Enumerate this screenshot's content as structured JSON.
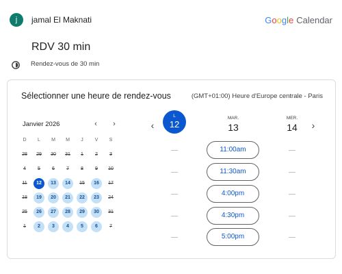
{
  "header": {
    "avatar_letter": "j",
    "user_name": "jamal El Maknati",
    "brand_g": [
      "G",
      "o",
      "o",
      "g",
      "l",
      "e"
    ],
    "brand_app": "Calendar"
  },
  "event": {
    "title": "RDV 30 min",
    "duration_text": "Rendez-vous de 30 min",
    "duration_icon": "clock-icon"
  },
  "booking": {
    "title": "Sélectionner une heure de rendez-vous",
    "timezone": "(GMT+01:00) Heure d'Europe centrale - Paris",
    "mini_calendar": {
      "month_label": "Janvier 2026",
      "prev": "‹",
      "next": "›",
      "weekdays": [
        "D",
        "L",
        "M",
        "M",
        "J",
        "V",
        "S"
      ],
      "weeks": [
        [
          {
            "d": "28",
            "s": "past"
          },
          {
            "d": "29",
            "s": "past"
          },
          {
            "d": "30",
            "s": "past"
          },
          {
            "d": "31",
            "s": "past"
          },
          {
            "d": "1",
            "s": "past"
          },
          {
            "d": "2",
            "s": "past"
          },
          {
            "d": "3",
            "s": "past"
          }
        ],
        [
          {
            "d": "4",
            "s": "past"
          },
          {
            "d": "5",
            "s": "past"
          },
          {
            "d": "6",
            "s": "past"
          },
          {
            "d": "7",
            "s": "past"
          },
          {
            "d": "8",
            "s": "past"
          },
          {
            "d": "9",
            "s": "past"
          },
          {
            "d": "10",
            "s": "past"
          }
        ],
        [
          {
            "d": "11",
            "s": "past"
          },
          {
            "d": "12",
            "s": "selected"
          },
          {
            "d": "13",
            "s": "avail"
          },
          {
            "d": "14",
            "s": "avail"
          },
          {
            "d": "15",
            "s": "past"
          },
          {
            "d": "16",
            "s": "avail"
          },
          {
            "d": "17",
            "s": "past"
          }
        ],
        [
          {
            "d": "18",
            "s": "past"
          },
          {
            "d": "19",
            "s": "avail"
          },
          {
            "d": "20",
            "s": "avail"
          },
          {
            "d": "21",
            "s": "avail"
          },
          {
            "d": "22",
            "s": "avail"
          },
          {
            "d": "23",
            "s": "avail"
          },
          {
            "d": "24",
            "s": "past"
          }
        ],
        [
          {
            "d": "25",
            "s": "past"
          },
          {
            "d": "26",
            "s": "avail"
          },
          {
            "d": "27",
            "s": "avail"
          },
          {
            "d": "28",
            "s": "avail"
          },
          {
            "d": "29",
            "s": "avail"
          },
          {
            "d": "30",
            "s": "avail"
          },
          {
            "d": "31",
            "s": "past"
          }
        ],
        [
          {
            "d": "1",
            "s": "past"
          },
          {
            "d": "2",
            "s": "avail"
          },
          {
            "d": "3",
            "s": "avail"
          },
          {
            "d": "4",
            "s": "avail"
          },
          {
            "d": "5",
            "s": "avail"
          },
          {
            "d": "6",
            "s": "avail"
          },
          {
            "d": "7",
            "s": "past"
          }
        ]
      ]
    },
    "columns_prev": "‹",
    "columns_next": "›",
    "columns": [
      {
        "dow": "L",
        "num": "12",
        "selected": true
      },
      {
        "dow": "MAR.",
        "num": "13",
        "selected": false
      },
      {
        "dow": "MER.",
        "num": "14",
        "selected": false
      }
    ],
    "slots": [
      "11:00am",
      "11:30am",
      "4:00pm",
      "4:30pm",
      "5:00pm"
    ],
    "empty_marker": "—"
  },
  "colors": {
    "accent": "#0b57d0",
    "available_day": "#c2e0f7",
    "avatar": "#0f7b6c"
  }
}
